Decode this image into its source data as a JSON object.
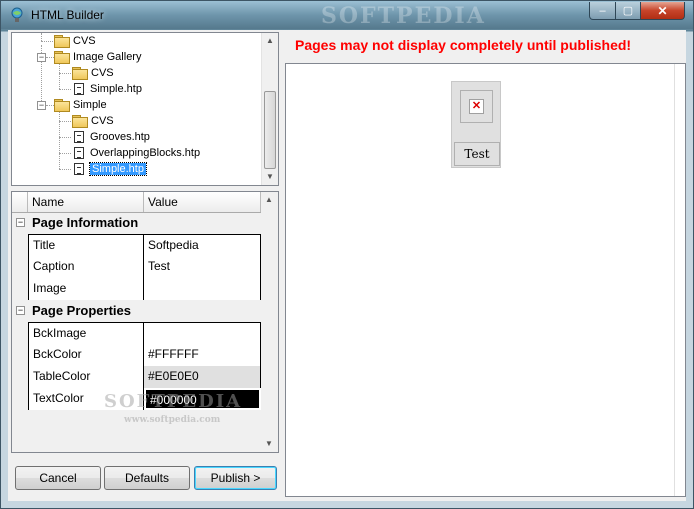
{
  "window": {
    "title": "HTML Builder",
    "controls": {
      "minimize": "–",
      "maximize": "▢",
      "close": "✕"
    },
    "watermark": "SOFTPEDIA"
  },
  "tree": {
    "items": [
      {
        "label": "CVS",
        "icon": "folder-icon",
        "expander": ""
      },
      {
        "label": "Image Gallery",
        "icon": "folder-icon",
        "expander": "−"
      },
      {
        "label": "CVS",
        "icon": "folder-icon",
        "expander": ""
      },
      {
        "label": "Simple.htp",
        "icon": "document-icon",
        "expander": ""
      },
      {
        "label": "Simple",
        "icon": "folder-icon",
        "expander": "−"
      },
      {
        "label": "CVS",
        "icon": "folder-icon",
        "expander": ""
      },
      {
        "label": "Grooves.htp",
        "icon": "document-icon",
        "expander": ""
      },
      {
        "label": "OverlappingBlocks.htp",
        "icon": "document-icon",
        "expander": ""
      },
      {
        "label": "Simple.htp",
        "icon": "document-icon",
        "expander": "",
        "selected": true
      }
    ]
  },
  "grid": {
    "headers": {
      "name": "Name",
      "value": "Value"
    },
    "categories": [
      {
        "label": "Page Information",
        "expander": "−",
        "rows": [
          {
            "name": "Title",
            "value": "Softpedia"
          },
          {
            "name": "Caption",
            "value": "Test"
          },
          {
            "name": "Image",
            "value": ""
          }
        ]
      },
      {
        "label": "Page Properties",
        "expander": "−",
        "rows": [
          {
            "name": "BckImage",
            "value": ""
          },
          {
            "name": "BckColor",
            "value": "#FFFFFF",
            "swatch": "#FFFFFF",
            "text_color": "#000000"
          },
          {
            "name": "TableColor",
            "value": "#E0E0E0",
            "swatch": "#E0E0E0",
            "text_color": "#000000"
          },
          {
            "name": "TextColor",
            "value": "#000000",
            "swatch": "#000000",
            "text_color": "#FFFFFF"
          }
        ]
      }
    ],
    "watermark": "SOFTPEDIA",
    "watermark_url": "www.softpedia.com"
  },
  "buttons": {
    "cancel": "Cancel",
    "defaults": "Defaults",
    "publish": "Publish >"
  },
  "preview": {
    "warning": "Pages may not display completely until published!",
    "caption": "Test",
    "broken_image_glyph": "✕",
    "table_color": "#E0E0E0",
    "background": "#FFFFFF"
  },
  "colors": {
    "warning": "#FF0000",
    "selection": "#3399FF"
  }
}
